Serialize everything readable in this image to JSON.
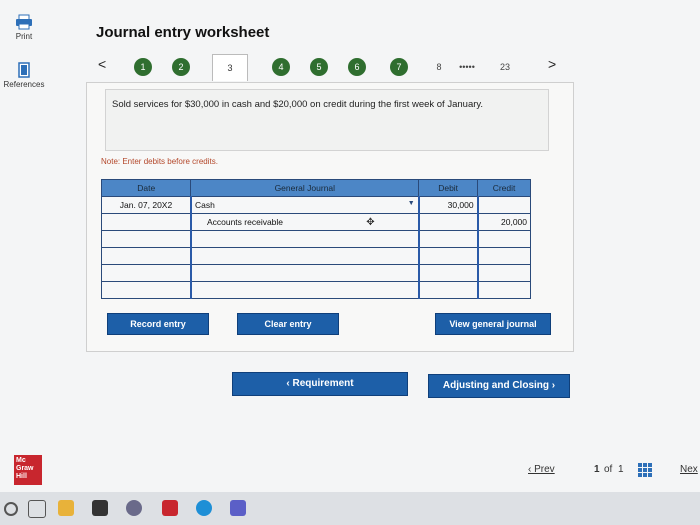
{
  "sidebar": {
    "print_label": "Print",
    "references_label": "References"
  },
  "header": {
    "title": "Journal entry worksheet"
  },
  "steps": {
    "prev_arrow": "<",
    "next_arrow": ">",
    "items": [
      "1",
      "2",
      "3",
      "4",
      "5",
      "6",
      "7",
      "8"
    ],
    "ellipsis": "•••••",
    "last": "23",
    "current": "3"
  },
  "question": {
    "text": "Sold services for $30,000 in cash and $20,000 on credit during the first week of January."
  },
  "note": "Note: Enter debits before credits.",
  "journal": {
    "headers": [
      "Date",
      "General Journal",
      "Debit",
      "Credit"
    ],
    "rows": [
      {
        "date": "Jan. 07, 20X2",
        "account": "Cash",
        "debit": "30,000",
        "credit": ""
      },
      {
        "date": "",
        "account": "Accounts receivable",
        "debit": "",
        "credit": "20,000"
      },
      {
        "date": "",
        "account": "",
        "debit": "",
        "credit": ""
      },
      {
        "date": "",
        "account": "",
        "debit": "",
        "credit": ""
      },
      {
        "date": "",
        "account": "",
        "debit": "",
        "credit": ""
      },
      {
        "date": "",
        "account": "",
        "debit": "",
        "credit": ""
      }
    ]
  },
  "buttons": {
    "record": "Record entry",
    "clear": "Clear entry",
    "view": "View general journal",
    "requirement": "‹  Requirement",
    "adjusting": "Adjusting and Closing  ›"
  },
  "footer": {
    "logo": "Mc Graw Hill",
    "prev": "‹  Prev",
    "page": "1",
    "of": "of",
    "total": "1",
    "next": "Nex"
  },
  "colors": {
    "accent": "#1d5fa8",
    "step_green": "#2f6e2f",
    "header_blue": "#4c86c6",
    "note_red": "#b3472a",
    "logo_red": "#c8262e"
  }
}
